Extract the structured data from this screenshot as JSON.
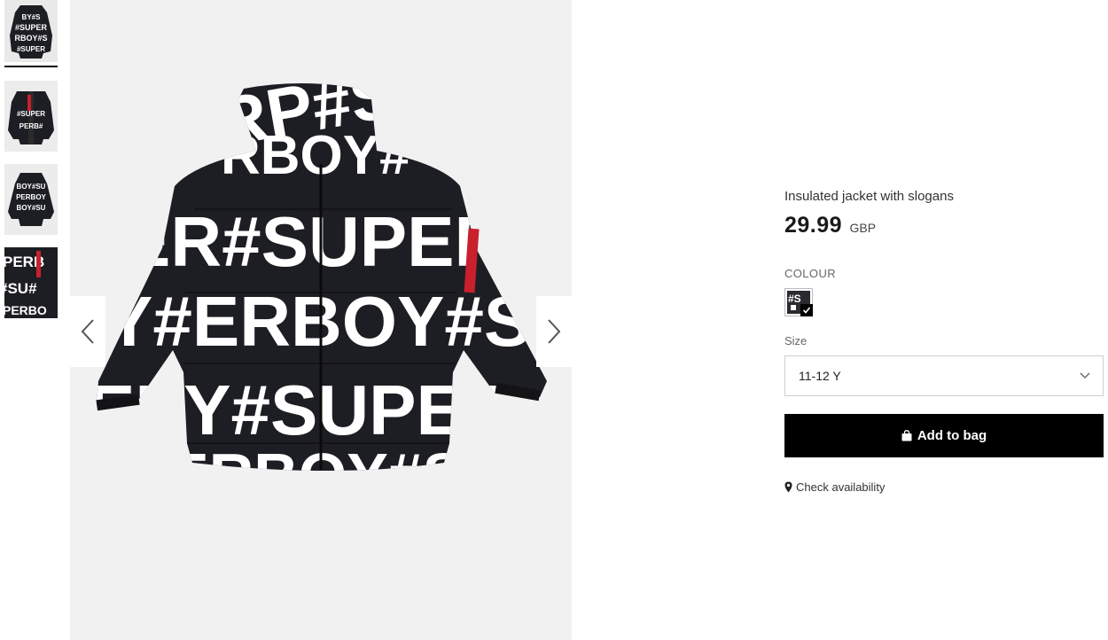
{
  "gallery": {
    "thumbnails": [
      {
        "alt": "jacket-front-thumbnail",
        "active": true
      },
      {
        "alt": "jacket-open-thumbnail",
        "active": false
      },
      {
        "alt": "jacket-back-thumbnail",
        "active": false
      },
      {
        "alt": "jacket-detail-thumbnail",
        "active": false
      }
    ],
    "main_image_print": "#SUPERBOY",
    "prev_label": "previous-image",
    "next_label": "next-image"
  },
  "product": {
    "title": "Insulated jacket with slogans",
    "price": "29.99",
    "currency": "GBP",
    "colour_label": "COLOUR",
    "size_label": "Size",
    "selected_size": "11-12 Y",
    "add_to_bag_label": "Add to bag",
    "check_availability_label": "Check availability"
  },
  "colors": {
    "jacket_base": "#1d1e24",
    "print": "#ffffff",
    "tag_red": "#c8202c",
    "button_bg": "#000000",
    "image_bg": "#f1f1f1"
  }
}
